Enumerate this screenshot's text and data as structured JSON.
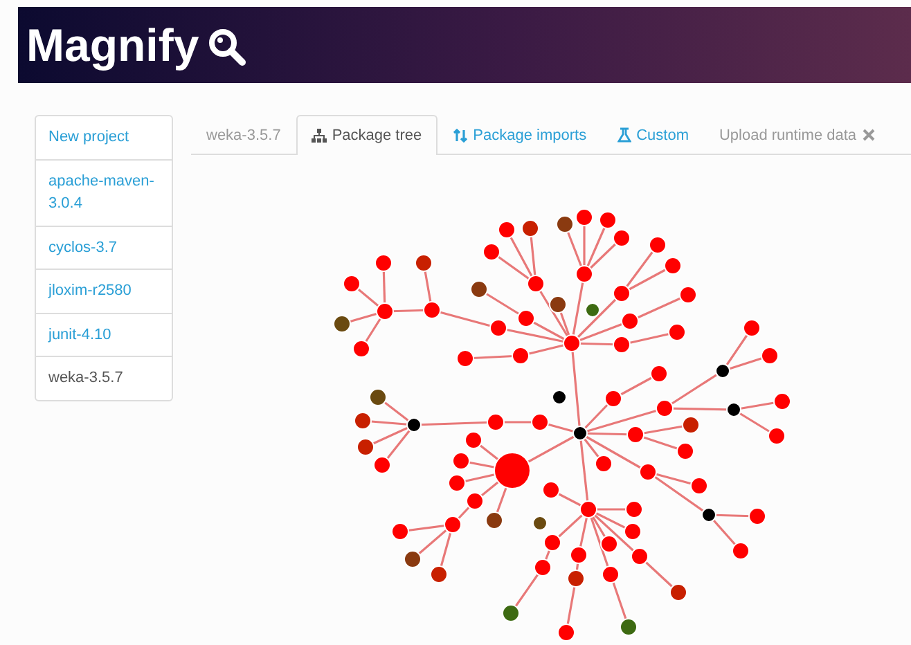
{
  "header": {
    "title": "Magnify"
  },
  "sidebar": {
    "items": [
      {
        "label": "New project",
        "selected": false
      },
      {
        "label": "apache-maven-3.0.4",
        "selected": false
      },
      {
        "label": "cyclos-3.7",
        "selected": false
      },
      {
        "label": "jloxim-r2580",
        "selected": false
      },
      {
        "label": "junit-4.10",
        "selected": false
      },
      {
        "label": "weka-3.5.7",
        "selected": true
      }
    ]
  },
  "tabs": [
    {
      "label": "weka-3.5.7",
      "kind": "heading",
      "selected": false,
      "disabled": true
    },
    {
      "label": "Package tree",
      "kind": "tree",
      "selected": true,
      "disabled": false
    },
    {
      "label": "Package imports",
      "kind": "imports",
      "selected": false,
      "disabled": false
    },
    {
      "label": "Custom",
      "kind": "flask",
      "selected": false,
      "disabled": false
    },
    {
      "label": "Upload runtime data",
      "kind": "upload",
      "selected": false,
      "disabled": true
    }
  ]
}
